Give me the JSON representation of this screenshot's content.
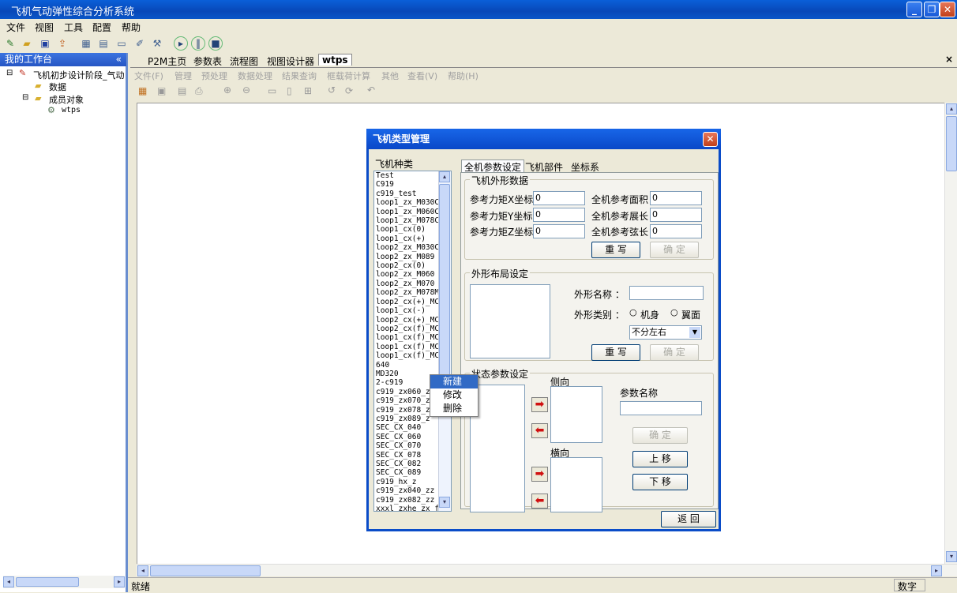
{
  "window": {
    "title": "飞机气动弹性综合分析系统"
  },
  "menu": [
    "文件",
    "视图",
    "工具",
    "配置",
    "帮助"
  ],
  "sidebar": {
    "header": "我的工作台",
    "tree": {
      "root": "飞机初步设计阶段_气动",
      "data": "数据",
      "members": "成员对象",
      "item": "wtps"
    }
  },
  "tabs": [
    "P2M主页",
    "参数表",
    "流程图",
    "视图设计器",
    "wtps"
  ],
  "submenu": [
    "文件(F)",
    "管理",
    "预处理",
    "数据处理",
    "结果查询",
    "框载荷计算",
    "其他",
    "查看(V)",
    "帮助(H)"
  ],
  "status": {
    "left": "就绪",
    "right": "数字"
  },
  "dialog": {
    "title": "飞机类型管理",
    "list_label": "飞机种类",
    "aircraft": [
      "Test",
      "C919",
      "c919_test",
      "loop1_zx_M030C",
      "loop1_zx_M060C",
      "loop1_zx_M078C",
      "loop1_cx(0)",
      "loop1_cx(+)",
      "loop2_zx_M030C",
      "loop2_zx_M089",
      "loop2_cx(0)",
      "loop2_zx_M060",
      "loop2_zx_M070",
      "loop2_zx_M078M",
      "loop2_cx(+)_MC",
      "loop1_cx(-)",
      "loop2_cx(+)_MC",
      "loop2_cx(f)_MC",
      "loop1_cx(f)_MC",
      "loop1_cx(f)_MC",
      "loop1_cx(f)_MC",
      "640",
      "MD320",
      "2-c919",
      "c919_zx060_z",
      "c919_zx070_z",
      "c919_zx078_z",
      "c919_zx089_z",
      "SEC_CX_040",
      "SEC_CX_060",
      "SEC_CX_070",
      "SEC_CX_078",
      "SEC_CX_082",
      "SEC_CX_089",
      "c919_hx_z",
      "c919_zx040_zz",
      "c919_zx082_zz",
      "xxxl_zxhe_zx_f"
    ],
    "context_menu": [
      "新建",
      "修改",
      "删除"
    ],
    "tabs": [
      "全机参数设定",
      "飞机部件",
      "坐标系"
    ],
    "shape_group": {
      "title": "飞机外形数据",
      "fields": [
        {
          "label": "参考力矩X坐标",
          "value": "0"
        },
        {
          "label": "全机参考面积",
          "value": "0"
        },
        {
          "label": "参考力矩Y坐标",
          "value": "0"
        },
        {
          "label": "全机参考展长",
          "value": "0"
        },
        {
          "label": "参考力矩Z坐标",
          "value": "0"
        },
        {
          "label": "全机参考弦长",
          "value": "0"
        }
      ],
      "rewrite": "重 写",
      "confirm": "确 定"
    },
    "layout_group": {
      "title": "外形布局设定",
      "name_label": "外形名称 ：",
      "name_value": "",
      "type_label": "外形类别 ：",
      "radio1": "机身",
      "radio2": "翼面",
      "select": "不分左右",
      "rewrite": "重 写",
      "confirm": "确 定"
    },
    "state_group": {
      "title": "状态参数设定",
      "lateral": "侧向",
      "longitudinal": "横向",
      "param_name": "参数名称",
      "param_value": "",
      "confirm": "确 定",
      "up": "上 移",
      "down": "下 移"
    },
    "return": "返 回"
  }
}
